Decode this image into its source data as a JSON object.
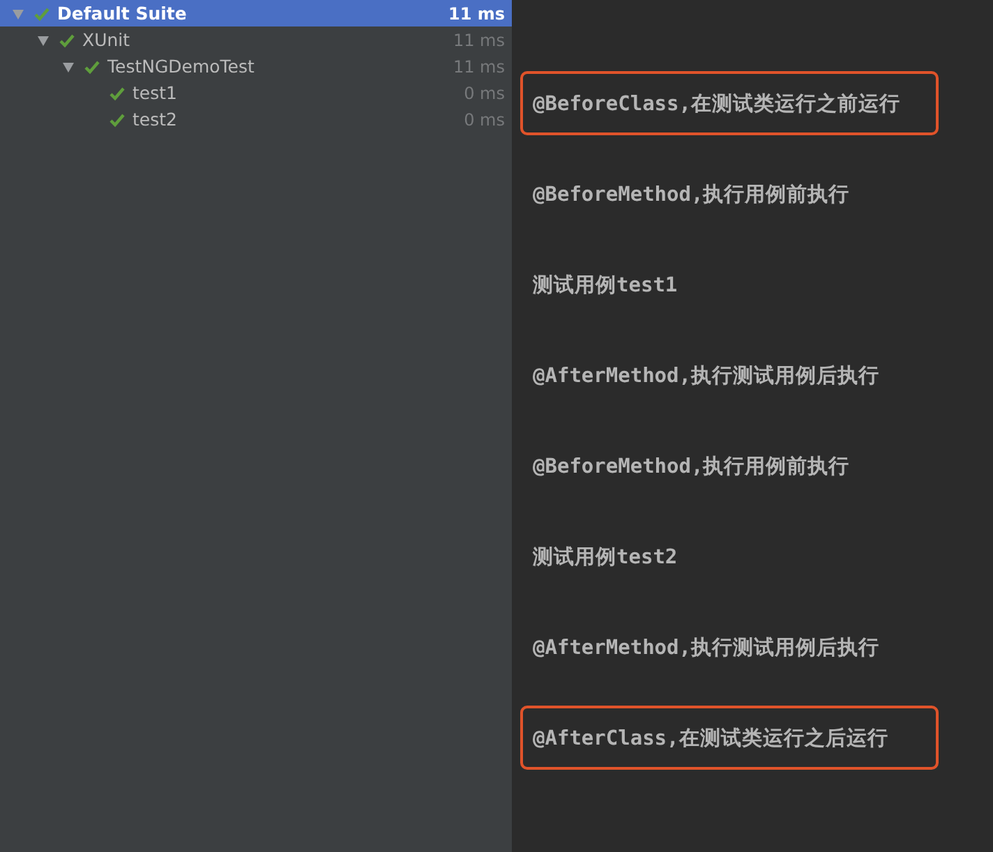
{
  "test_tree": [
    {
      "label": "Default Suite",
      "time": "11 ms",
      "kind": "passed",
      "expanded": true,
      "selected": true,
      "children": [
        {
          "label": "XUnit",
          "time": "11 ms",
          "kind": "passed",
          "expanded": true,
          "selected": false,
          "children": [
            {
              "label": "TestNGDemoTest",
              "time": "11 ms",
              "kind": "passed",
              "expanded": true,
              "selected": false,
              "children": [
                {
                  "label": "test1",
                  "time": "0 ms",
                  "kind": "passed",
                  "selected": false
                },
                {
                  "label": "test2",
                  "time": "0 ms",
                  "kind": "passed",
                  "selected": false
                }
              ]
            }
          ]
        }
      ]
    }
  ],
  "console_output": [
    {
      "text": "@BeforeClass,在测试类运行之前运行",
      "highlighted": true
    },
    {
      "text": "@BeforeMethod,执行用例前执行",
      "highlighted": false
    },
    {
      "text": "测试用例test1",
      "highlighted": false
    },
    {
      "text": "@AfterMethod,执行测试用例后执行",
      "highlighted": false
    },
    {
      "text": "@BeforeMethod,执行用例前执行",
      "highlighted": false
    },
    {
      "text": "测试用例test2",
      "highlighted": false
    },
    {
      "text": "@AfterMethod,执行测试用例后执行",
      "highlighted": false
    },
    {
      "text": "@AfterClass,在测试类运行之后运行",
      "highlighted": true
    }
  ]
}
